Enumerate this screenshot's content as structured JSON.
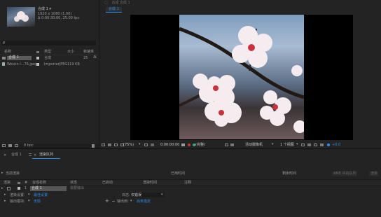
{
  "project": {
    "comp_name": "合成 1 ▾",
    "comp_size": "1920 x 1080 (1.00)",
    "comp_duration": "Δ 0:00:30:00, 25.00 fps",
    "search_placeholder": "ρ",
    "columns": [
      "名称",
      "类型",
      "大小",
      "帧速率"
    ],
    "items": [
      {
        "name": "合成 1",
        "type": "合成",
        "size": "",
        "fps": "25"
      },
      {
        "name": "Weixin I...76.jpeg",
        "type": "ImporterJPEG",
        "size": "119 KB",
        "fps": ""
      }
    ],
    "bpc": "8 bpc"
  },
  "viewer": {
    "header_label": "合成 合成 1",
    "tab": "合成 1",
    "zoom": "(75%)",
    "timecode": "0:00:00:00",
    "quality": "(完整)",
    "camera": "活动摄像机",
    "views": "1 个视图",
    "exposure": "+0.0"
  },
  "timeline": {
    "tab_comp": "合成 1",
    "tab_render": "渲染队列",
    "current_render": "当前渲染",
    "elapsed": "已用时间",
    "remaining": "剩余时间",
    "ame_queue": "AME 中的队列",
    "render_button": "渲染",
    "cols": [
      "渲染",
      "#",
      "合成名称",
      "状态",
      "已启动",
      "渲染时间",
      "注释"
    ],
    "row": {
      "num": "1",
      "comp": "合成 1",
      "status": "需要输出"
    },
    "render_settings_label": "渲染设置:",
    "render_settings_value": "最佳设置",
    "log_label": "日志:",
    "log_value": "仅错误",
    "output_module_label": "输出模块:",
    "output_module_value": "无损",
    "output_to_label": "输出到:",
    "output_to_value": "尚未指定"
  },
  "colors": {
    "accent": "#2d8ceb",
    "bg": "#1d1d1d",
    "panel": "#232323"
  }
}
